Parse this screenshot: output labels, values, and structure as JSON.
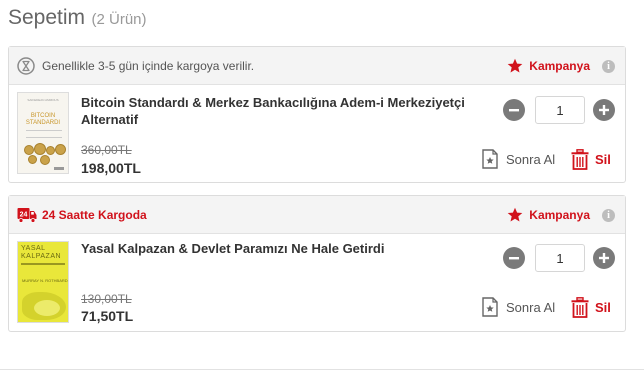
{
  "cart": {
    "title": "Sepetim",
    "item_count": "(2 Ürün)"
  },
  "groups": [
    {
      "shipping_text": "Genellikle 3-5 gün içinde kargoya verilir.",
      "shipping_icon": "hourglass-icon",
      "campaign_label": "Kampanya",
      "info_symbol": "i",
      "product": {
        "title": "Bitcoin Standardı & Merkez Bankacılığına Adem-i Merkeziyetçi Alternatif",
        "old_price": "360,00TL",
        "new_price": "198,00TL",
        "quantity": "1",
        "save_later_label": "Sonra Al",
        "remove_label": "Sil",
        "cover_author": "SAIFEDEAN AMMOUS",
        "cover_title_line1": "BITCOIN",
        "cover_title_line2": "STANDARDI"
      }
    },
    {
      "shipping_text": "24 Saatte Kargoda",
      "shipping_icon": "fast-delivery-truck-icon",
      "shipping_badge": "24",
      "campaign_label": "Kampanya",
      "info_symbol": "i",
      "product": {
        "title": "Yasal Kalpazan & Devlet Paramızı Ne Hale Getirdi",
        "old_price": "130,00TL",
        "new_price": "71,50TL",
        "quantity": "1",
        "save_later_label": "Sonra Al",
        "remove_label": "Sil",
        "cover_title_line1": "YASAL",
        "cover_title_line2": "KALPAZAN",
        "cover_author": "MURRAY N. ROTHBARD"
      }
    }
  ],
  "colors": {
    "accent_red": "#d1121b",
    "button_gray": "#7a7a7a",
    "header_bg": "#f4f4f4",
    "title_gray": "#666666"
  }
}
